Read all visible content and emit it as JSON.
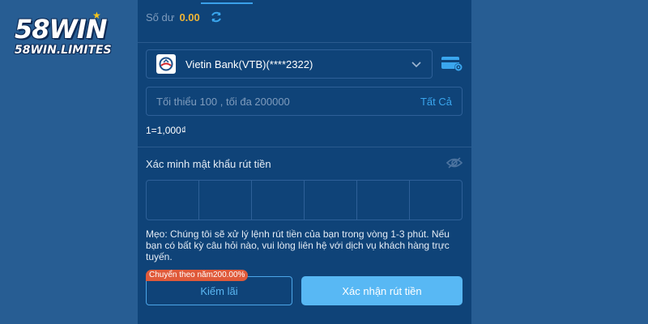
{
  "brand": {
    "logo_main": "58WIN",
    "logo_sub": "58WIN.LIMITES"
  },
  "balance": {
    "label": "Số dư",
    "value": "0.00"
  },
  "bank": {
    "name": "Vietin Bank(VTB)(****2322)"
  },
  "amount": {
    "placeholder": "Tối thiểu 100 , tối đa 200000",
    "value": "",
    "all_label": "Tất Cả"
  },
  "rate": "1=1,000₫",
  "verify": {
    "label": "Xác minh mật khẩu rút tiền",
    "pin_cells": 6
  },
  "tip": "Mẹo: Chúng tôi sẽ xử lý lệnh rút tiền của bạn trong vòng 1-3 phút. Nếu bạn có bất kỳ câu hỏi nào, vui lòng liên hệ với dịch vụ khách hàng trực tuyến.",
  "actions": {
    "earn_label": "Kiếm lãi",
    "earn_badge": "Chuyển theo năm200.00%",
    "confirm_label": "Xác nhận rút tiền"
  },
  "colors": {
    "page_bg": "#275d93",
    "panel_bg": "#0f4378",
    "accent": "#3aa6ee",
    "balance": "#f0b535",
    "badge": "#e05a3a",
    "confirm_bg": "#58b8f4"
  },
  "icons": {
    "refresh": "refresh-icon",
    "chevron": "chevron-down-icon",
    "card_settings": "card-settings-icon",
    "eye": "eye-hidden-icon",
    "bank_logo": "vietinbank-logo"
  }
}
